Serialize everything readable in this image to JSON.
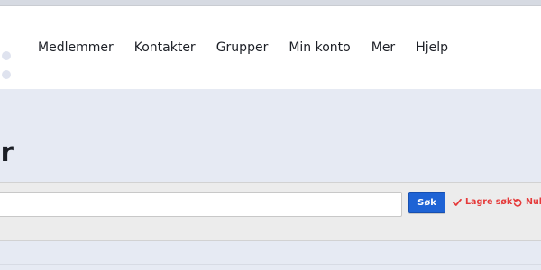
{
  "nav": {
    "items": [
      {
        "label": "Medlemmer"
      },
      {
        "label": "Kontakter"
      },
      {
        "label": "Grupper"
      },
      {
        "label": "Min konto"
      },
      {
        "label": "Mer"
      },
      {
        "label": "Hjelp"
      }
    ]
  },
  "page": {
    "title_fragment": "er"
  },
  "search": {
    "value": "",
    "button_label": "Søk",
    "save_label": "Lagre søk",
    "reset_label": "Null"
  },
  "colors": {
    "accent_blue": "#1e63d5",
    "action_red": "#e53b3b",
    "page_bg": "#e6eaf3"
  },
  "icons": {
    "save": "checkmark-icon",
    "reset": "reset-icon"
  }
}
